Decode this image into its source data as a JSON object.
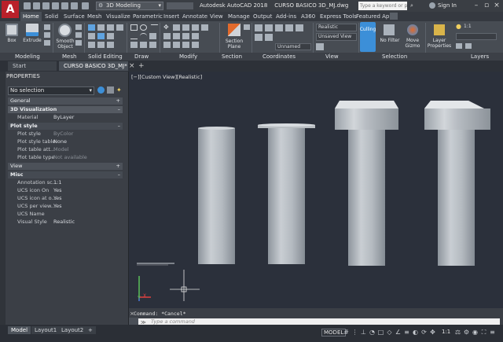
{
  "app": {
    "logo": "A",
    "title": "Autodesk AutoCAD 2018",
    "file": "CURSO BASICO 3D_MJ.dwg",
    "workspace": "3D Modeling",
    "search_placeholder": "Type a keyword or phrase",
    "sign_in": "Sign In"
  },
  "ribbon_tabs": [
    "Home",
    "Solid",
    "Surface",
    "Mesh",
    "Visualize",
    "Parametric",
    "Insert",
    "Annotate",
    "View",
    "Manage",
    "Output",
    "Add-ins",
    "A360",
    "Express Tools",
    "Featured Apps"
  ],
  "ribbon": {
    "box": "Box",
    "extrude": "Extrude",
    "smooth_object_1": "Smooth",
    "smooth_object_2": "Object",
    "section_plane_1": "Section",
    "section_plane_2": "Plane",
    "visual_style": "Realistic",
    "view": "Unsaved View",
    "coordinate": "Unnamed",
    "culling": "Culling",
    "no_filter": "No Filter",
    "move_gizmo_1": "Move",
    "move_gizmo_2": "Gizmo",
    "layer_props_1": "Layer",
    "layer_props_2": "Properties",
    "panels": [
      "Modeling",
      "Mesh",
      "Solid Editing",
      "Draw",
      "Modify",
      "Section",
      "Coordinates",
      "View",
      "Selection",
      "Layers"
    ],
    "layer_scale": "1:1"
  },
  "doc_tabs": [
    "Start",
    "CURSO BASICO 3D_MJ*"
  ],
  "properties": {
    "title": "PROPERTIES",
    "selection": "No selection",
    "sections": {
      "general": "General",
      "viz": "3D Visualization",
      "plot": "Plot style",
      "view": "View",
      "misc": "Misc"
    },
    "viz_rows": [
      {
        "k": "Material",
        "v": "ByLayer"
      }
    ],
    "plot_rows": [
      {
        "k": "Plot style",
        "v": "ByColor"
      },
      {
        "k": "Plot style table",
        "v": "None"
      },
      {
        "k": "Plot table att...",
        "v": "Model"
      },
      {
        "k": "Plot table type",
        "v": "Not available"
      }
    ],
    "misc_rows": [
      {
        "k": "Annotation sc...",
        "v": "1:1"
      },
      {
        "k": "UCS icon On",
        "v": "Yes"
      },
      {
        "k": "UCS icon at o...",
        "v": "Yes"
      },
      {
        "k": "UCS per view...",
        "v": "Yes"
      },
      {
        "k": "UCS Name",
        "v": ""
      },
      {
        "k": "Visual Style",
        "v": "Realistic"
      }
    ]
  },
  "viewport_label": "[−][Custom View][Realistic]",
  "ucs": {
    "x": "X",
    "y": "Y"
  },
  "command": {
    "log": "Command: *Cancel*",
    "placeholder": "Type a command"
  },
  "layout_tabs": [
    "Model",
    "Layout1",
    "Layout2"
  ],
  "status": {
    "model": "MODEL",
    "scale": "1:1"
  },
  "colors": {
    "accent": "#3c8fd8",
    "ribbon_bg": "#474c53",
    "viewport_bg": "#2b303b"
  }
}
